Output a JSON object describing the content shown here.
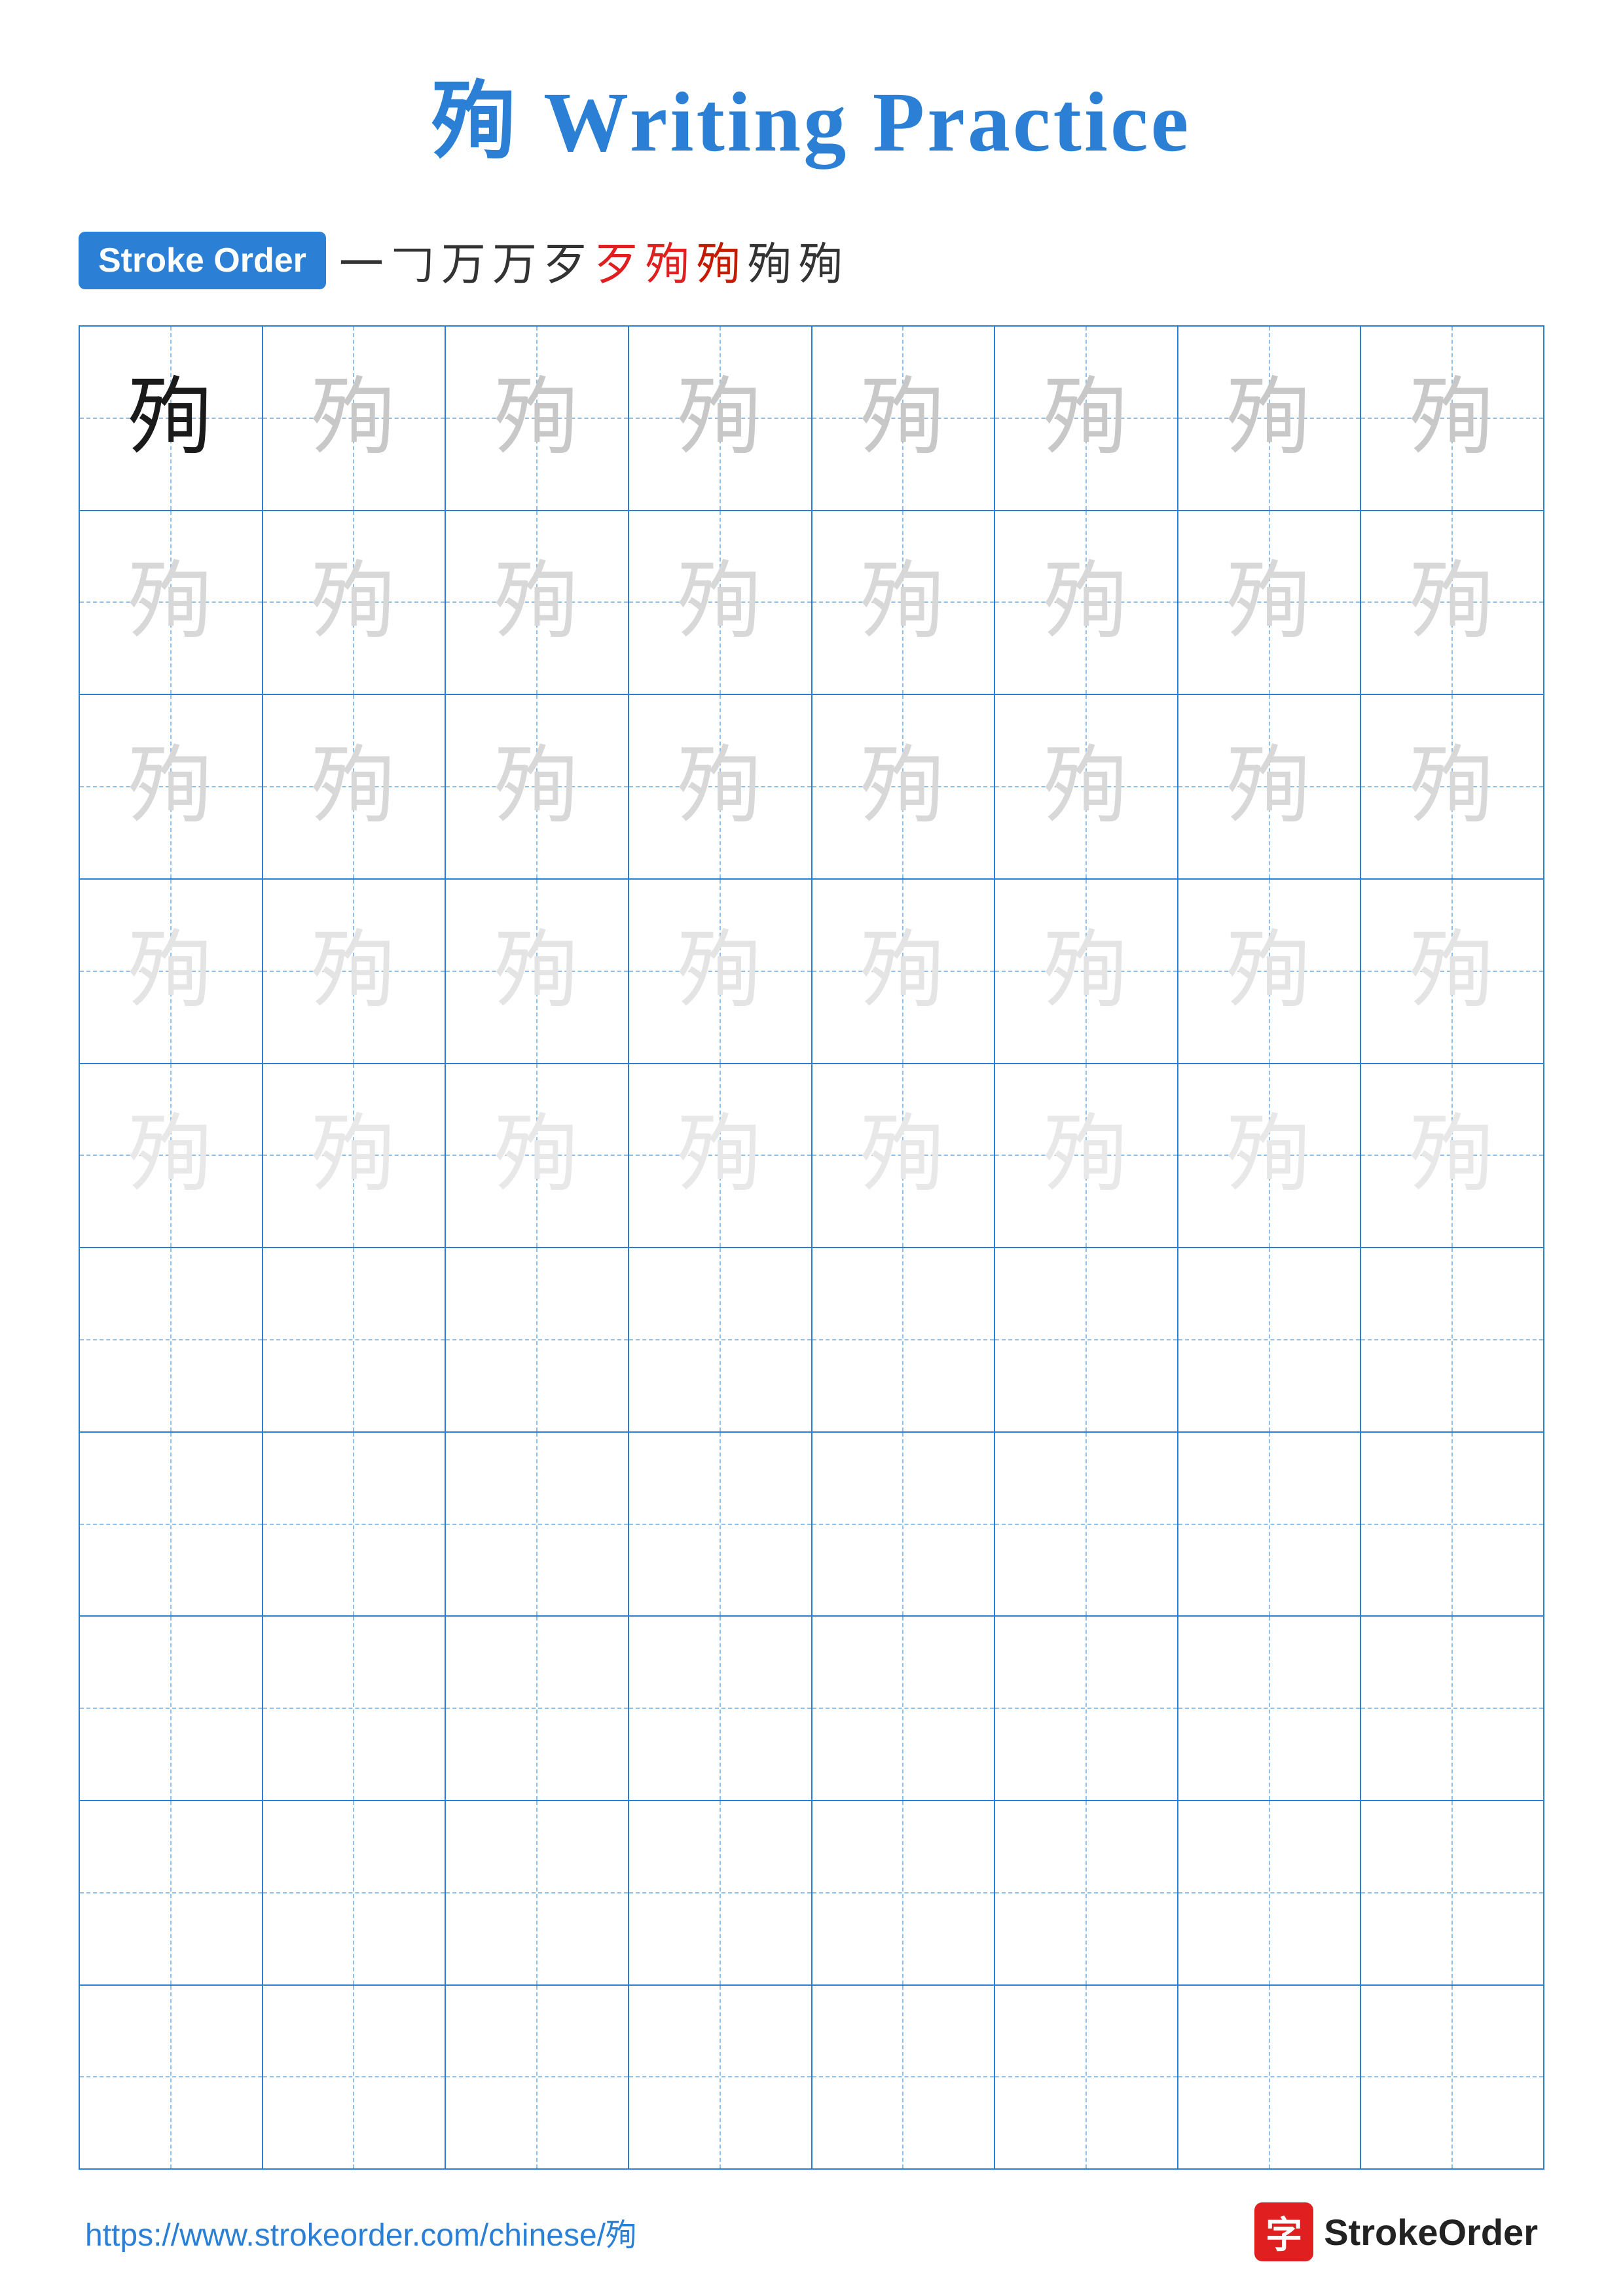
{
  "page": {
    "title": "殉 Writing Practice",
    "character": "殉",
    "stroke_order_label": "Stroke Order",
    "stroke_sequence": [
      "一",
      "𠃌",
      "万",
      "万",
      "歹",
      "歹",
      "殉",
      "殉",
      "殉",
      "殉"
    ],
    "stroke_sequence_colors": [
      "black",
      "black",
      "black",
      "black",
      "black",
      "red",
      "red",
      "dark-red",
      "black",
      "black"
    ],
    "grid": {
      "rows": 10,
      "cols": 8,
      "practice_rows": 5,
      "empty_rows": 5
    },
    "footer_url": "https://www.strokeorder.com/chinese/殉",
    "brand_icon_char": "字",
    "brand_name": "StrokeOrder"
  }
}
